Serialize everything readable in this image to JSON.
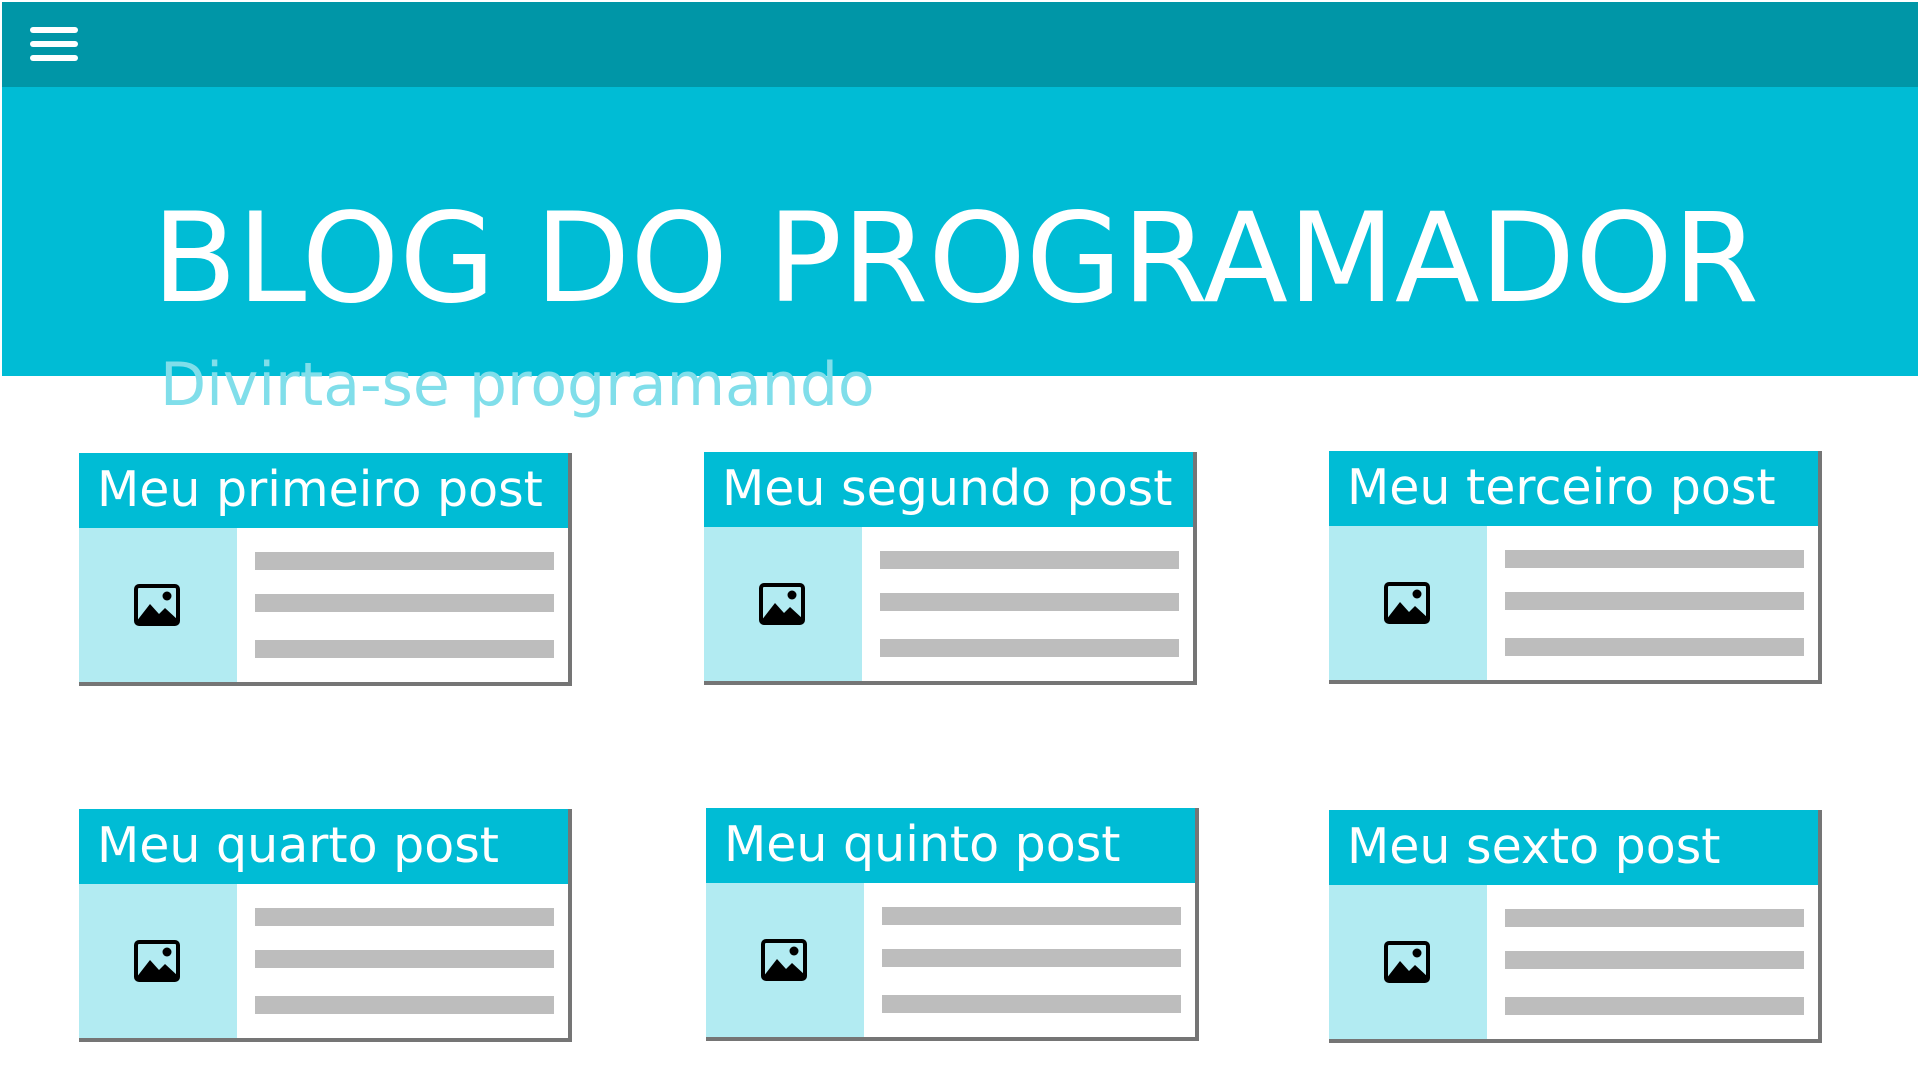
{
  "header": {
    "menu_icon": "hamburger-menu-icon",
    "title": "BLOG DO PROGRAMADOR",
    "subtitle": "Divirta-se programando"
  },
  "colors": {
    "topbar": "#0096a7",
    "hero": "#00bcd5",
    "subtitle": "#80deea",
    "thumb_bg": "#b2ebf2",
    "placeholder_line": "#bdbdbd",
    "card_shadow": "#757575"
  },
  "posts": [
    {
      "title": "Meu primeiro post",
      "thumbnail_icon": "image-icon"
    },
    {
      "title": "Meu segundo post",
      "thumbnail_icon": "image-icon"
    },
    {
      "title": "Meu terceiro post",
      "thumbnail_icon": "image-icon"
    },
    {
      "title": "Meu quarto post",
      "thumbnail_icon": "image-icon"
    },
    {
      "title": "Meu quinto post",
      "thumbnail_icon": "image-icon"
    },
    {
      "title": "Meu sexto post",
      "thumbnail_icon": "image-icon"
    }
  ]
}
